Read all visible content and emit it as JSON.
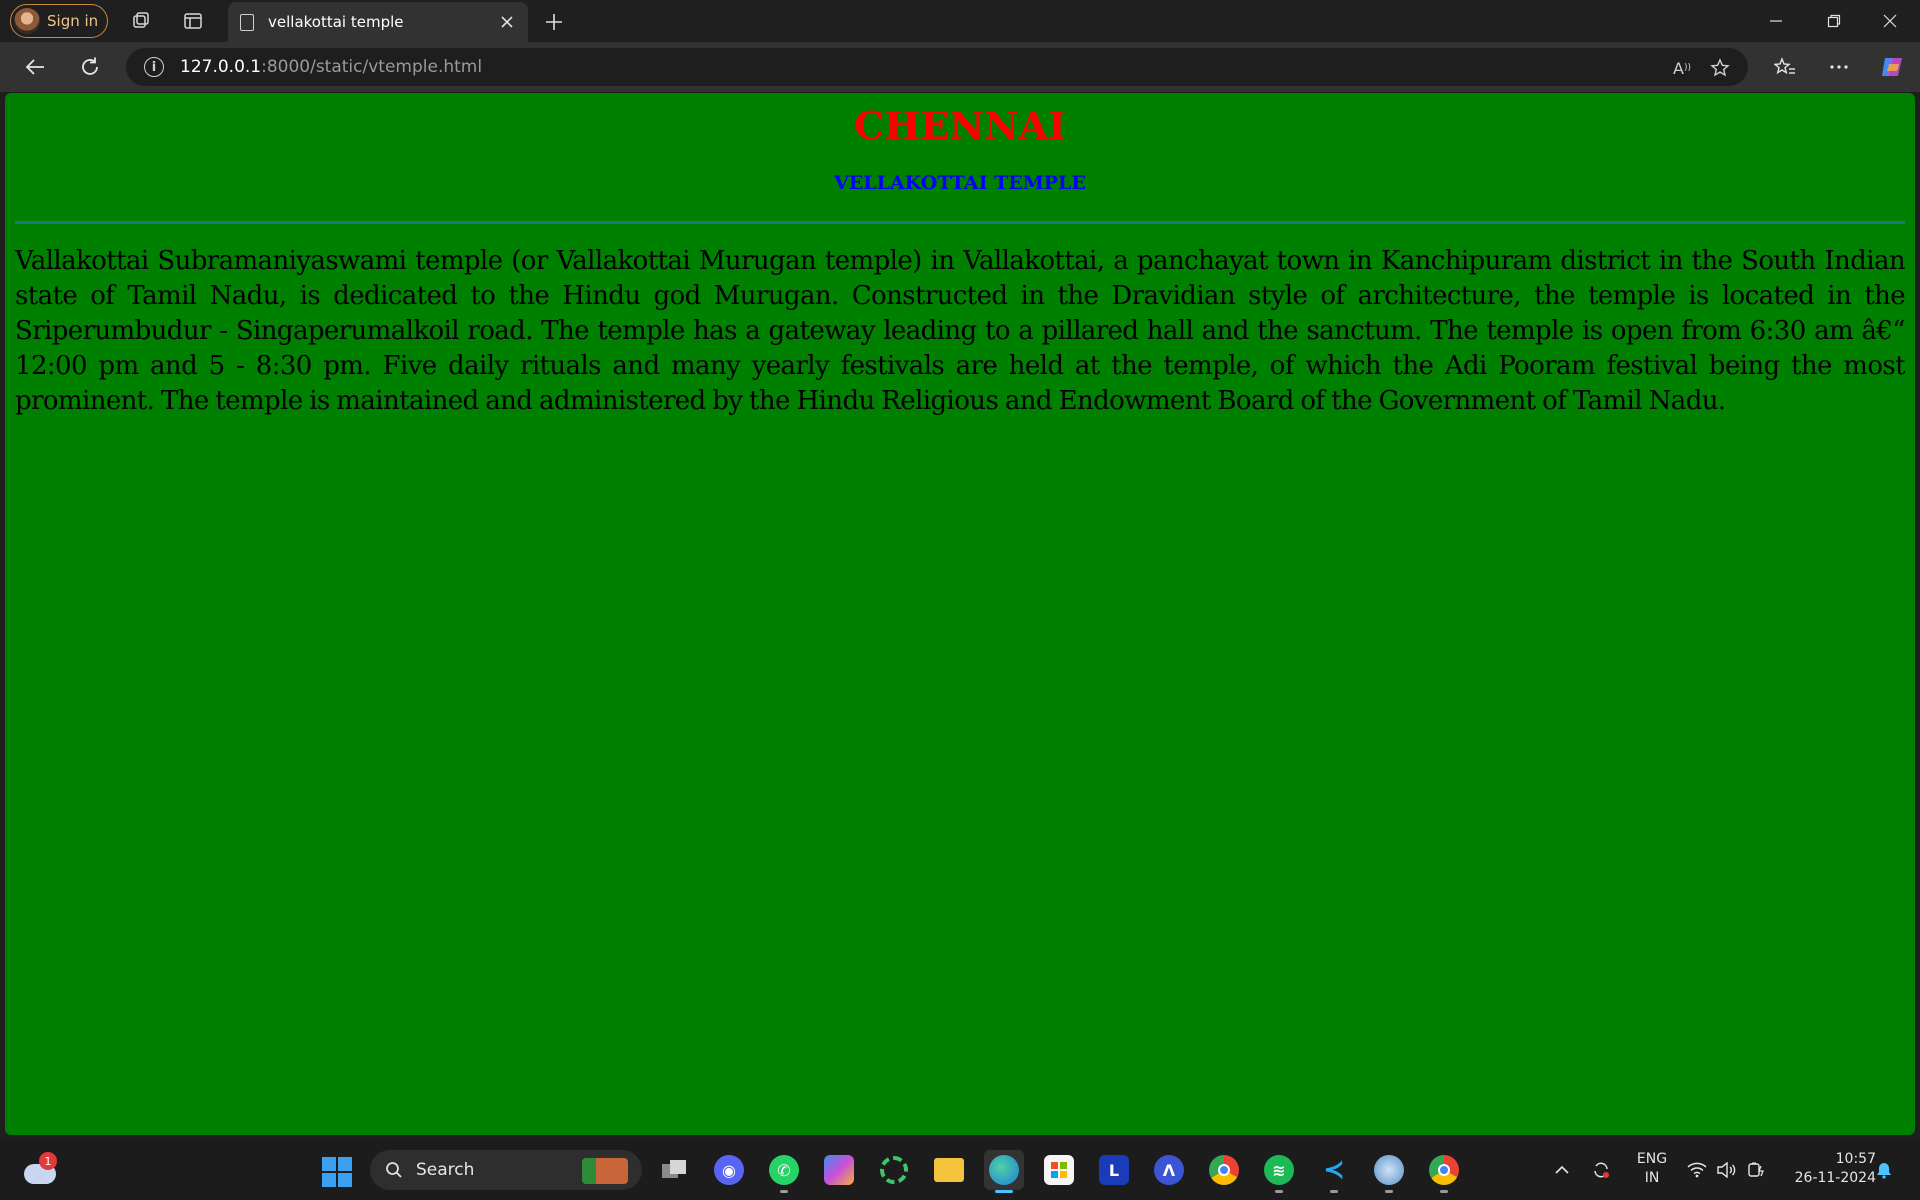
{
  "browser": {
    "signin_label": "Sign in",
    "tab_title": "vellakottai temple",
    "url_host": "127.0.0.1",
    "url_rest": ":8000/static/vtemple.html"
  },
  "page": {
    "heading": "CHENNAI",
    "subheading": "VELLAKOTTAI TEMPLE",
    "paragraph": "Vallakottai Subramaniyaswami temple (or Vallakottai Murugan temple) in Vallakottai, a panchayat town in Kanchipuram district in the South Indian state of Tamil Nadu, is dedicated to the Hindu god Murugan. Constructed in the Dravidian style of architecture, the temple is located in the Sriperumbudur - Singaperumalkoil road. The temple has a gateway leading to a pillared hall and the sanctum. The temple is open from 6:30 am â€“ 12:00 pm and 5 - 8:30 pm. Five daily rituals and many yearly festivals are held at the temple, of which the Adi Pooram festival being the most prominent. The temple is maintained and administered by the Hindu Religious and Endowment Board of the Government of Tamil Nadu."
  },
  "taskbar": {
    "weather_badge": "1",
    "search_label": "Search",
    "pinned_apps": [
      "task-view",
      "discord",
      "whatsapp",
      "copilot",
      "kde-connect",
      "file-explorer",
      "edge",
      "microsoft-store",
      "l-app",
      "vector-app",
      "chrome",
      "spotify",
      "vscode",
      "network-app",
      "chrome-profile"
    ],
    "lang_line1": "ENG",
    "lang_line2": "IN",
    "time": "10:57",
    "date": "26-11-2024"
  },
  "colors": {
    "page_background": "#008000",
    "heading": "#ff0000",
    "subheading": "#0000ff",
    "rule": "#1b7b7b"
  }
}
